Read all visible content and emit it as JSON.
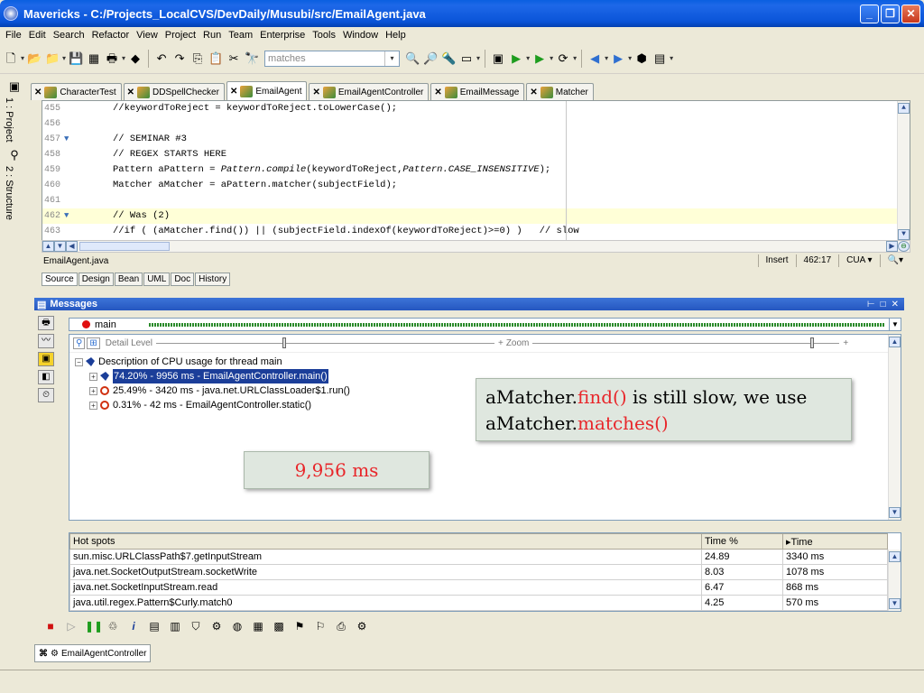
{
  "window": {
    "title": "Mavericks - C:/Projects_LocalCVS/DevDaily/Musubi/src/EmailAgent.java"
  },
  "menu": [
    "File",
    "Edit",
    "Search",
    "Refactor",
    "View",
    "Project",
    "Run",
    "Team",
    "Enterprise",
    "Tools",
    "Window",
    "Help"
  ],
  "toolbar": {
    "search_value": "matches"
  },
  "side_tabs": {
    "project": "1 : Project",
    "structure": "2 : Structure"
  },
  "editor_tabs": [
    {
      "label": "CharacterTest",
      "active": false
    },
    {
      "label": "DDSpellChecker",
      "active": false
    },
    {
      "label": "EmailAgent",
      "active": true
    },
    {
      "label": "EmailAgentController",
      "active": false
    },
    {
      "label": "EmailMessage",
      "active": false
    },
    {
      "label": "Matcher",
      "active": false
    }
  ],
  "code_lines": [
    {
      "n": "455",
      "text": "//keywordToReject = keywordToReject.toLowerCase();"
    },
    {
      "n": "456",
      "text": ""
    },
    {
      "n": "457",
      "text": "// SEMINAR #3",
      "fold": true
    },
    {
      "n": "458",
      "text": "// REGEX STARTS HERE"
    },
    {
      "n": "459",
      "pre": "Pattern aPattern = ",
      "it1": "Pattern.compile",
      "mid": "(keywordToReject,",
      "it2": "Pattern.CASE_INSENSITIVE",
      "post": ");"
    },
    {
      "n": "460",
      "text": "Matcher aMatcher = aPattern.matcher(subjectField);"
    },
    {
      "n": "461",
      "text": ""
    },
    {
      "n": "462",
      "text": "// Was (2)",
      "fold": true,
      "hl": true
    },
    {
      "n": "463",
      "text": "//if ( (aMatcher.find()) || (subjectField.indexOf(keywordToReject)>=0) )   // slow"
    }
  ],
  "status": {
    "file": "EmailAgent.java",
    "mode": "Insert",
    "position": "462:17",
    "keymap": "CUA"
  },
  "subtabs": [
    "Source",
    "Design",
    "Bean",
    "UML",
    "Doc",
    "History"
  ],
  "messages": {
    "title": "Messages",
    "thread": "main",
    "detail_label": "Detail Level",
    "zoom_label": "Zoom",
    "tree_root": "Description of CPU usage for thread main",
    "tree_nodes": [
      {
        "label": "74.20% - 9956 ms - EmailAgentController.main()",
        "selected": true,
        "icon": "blue"
      },
      {
        "label": "25.49% - 3420 ms - java.net.URLClassLoader$1.run()",
        "selected": false,
        "icon": "red"
      },
      {
        "label": "0.31% - 42 ms - EmailAgentController.static()",
        "selected": false,
        "icon": "red"
      }
    ]
  },
  "callouts": {
    "find_prefix": "aMatcher.",
    "find_red": "find()",
    "find_mid": " is still slow, we use aMatcher.",
    "matches_red": "matches()",
    "ms": "9,956 ms"
  },
  "hotspots": {
    "headers": [
      "Hot spots",
      "Time %",
      "Time"
    ],
    "rows": [
      [
        "sun.misc.URLClassPath$7.getInputStream",
        "24.89",
        "3340 ms"
      ],
      [
        "java.net.SocketOutputStream.socketWrite",
        "8.03",
        "1078 ms"
      ],
      [
        "java.net.SocketInputStream.read",
        "6.47",
        "868 ms"
      ],
      [
        "java.util.regex.Pattern$Curly.match0",
        "4.25",
        "570 ms"
      ]
    ]
  },
  "bottom_tab": "EmailAgentController",
  "colors": {
    "accent": "#1b3e99",
    "callout_red": "#e8262a",
    "titlebar": "#0a54d8"
  }
}
